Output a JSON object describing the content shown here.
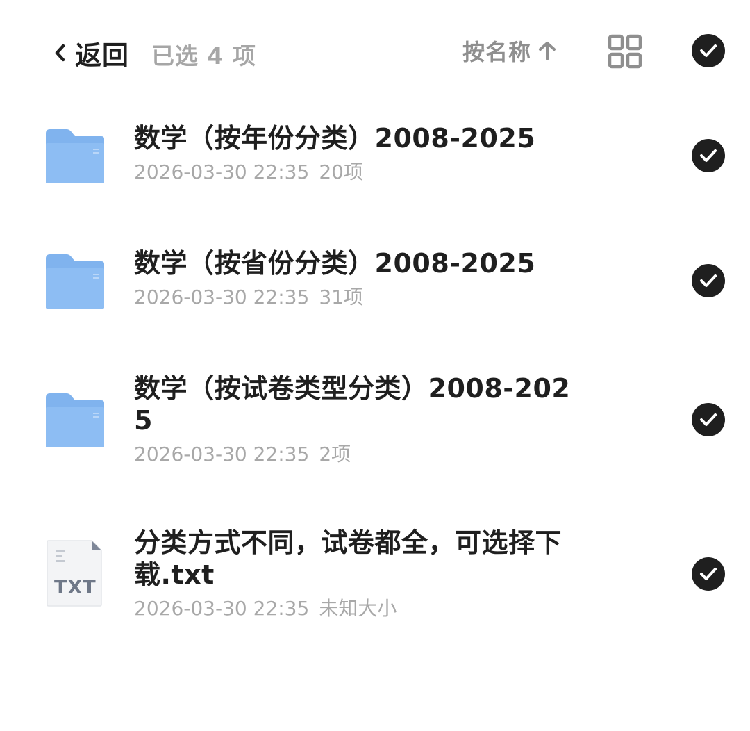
{
  "header": {
    "back_label": "返回",
    "selected_count": "已选 4 项",
    "sort_label": "按名称"
  },
  "colors": {
    "folder": "#80b3ee",
    "text_primary": "#1f1f1f",
    "text_secondary": "#a8a8a8",
    "check_fill": "#1f1f1f"
  },
  "files": [
    {
      "name": "数学（按年份分类）2008-2025",
      "date": "2026-03-30 22:35",
      "size": "20项",
      "icon": "folder-icon",
      "selected": true
    },
    {
      "name": "数学（按省份分类）2008-2025",
      "date": "2026-03-30 22:35",
      "size": "31项",
      "icon": "folder-icon",
      "selected": true
    },
    {
      "name": "数学（按试卷类型分类）2008-2025",
      "date": "2026-03-30 22:35",
      "size": "2项",
      "icon": "folder-icon",
      "selected": true
    },
    {
      "name": "分类方式不同，试卷都全，可选择下载.txt",
      "date": "2026-03-30 22:35",
      "size": "未知大小",
      "icon": "txt-file-icon",
      "icon_label": "TXT",
      "selected": true
    }
  ]
}
